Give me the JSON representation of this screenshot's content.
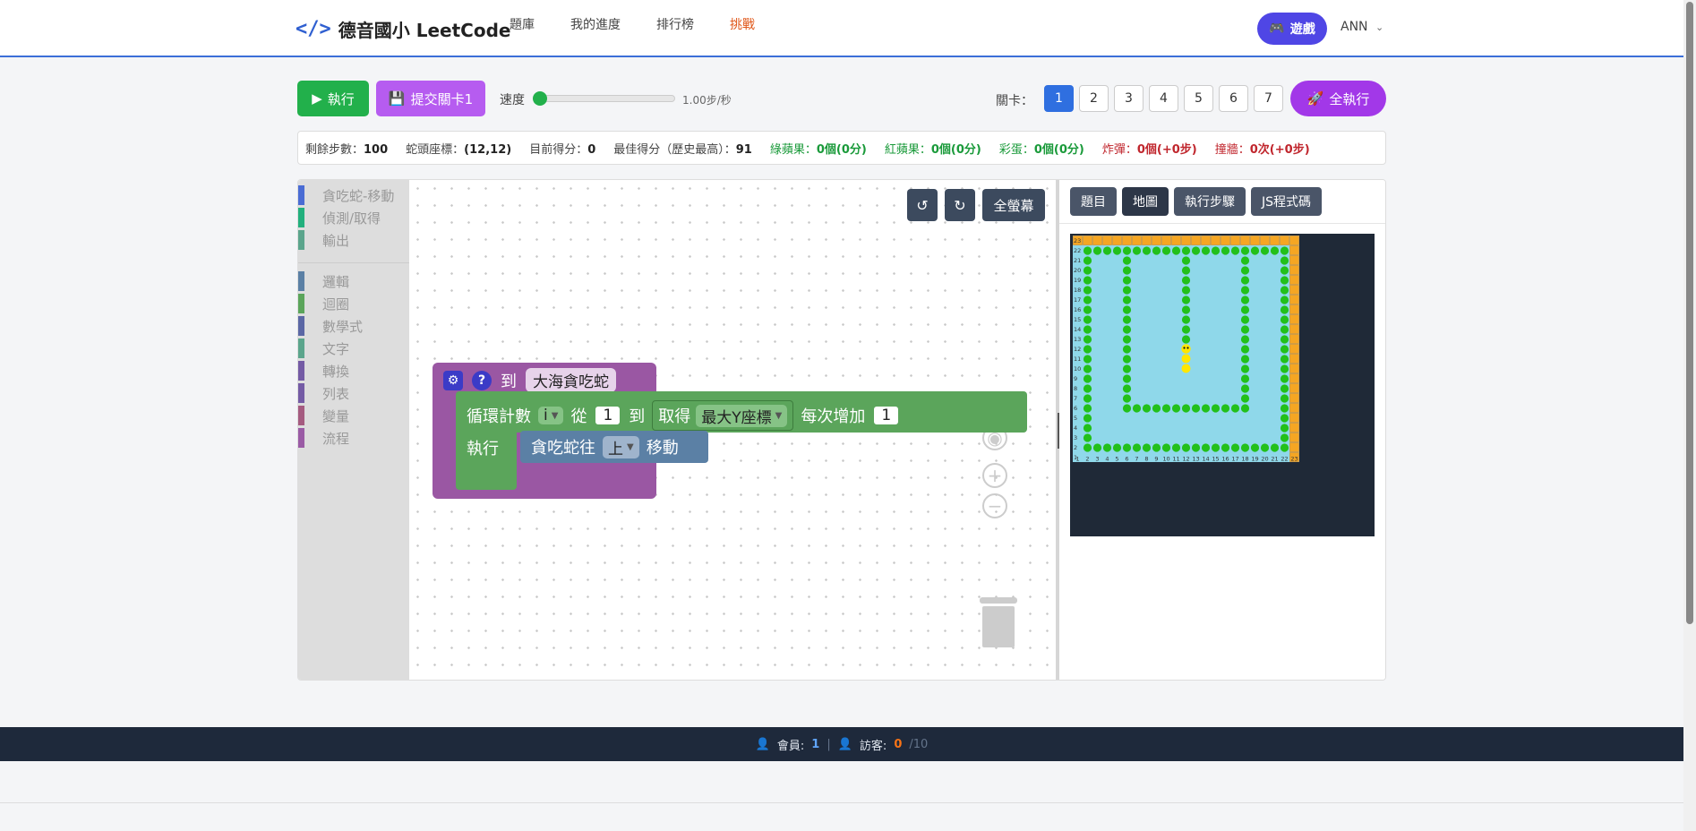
{
  "brand": {
    "name": "德音國小 LeetCode",
    "icon": "code-icon"
  },
  "nav": {
    "items": [
      {
        "label": "題庫",
        "active": false
      },
      {
        "label": "我的進度",
        "active": false
      },
      {
        "label": "排行榜",
        "active": false
      },
      {
        "label": "挑戰",
        "active": true
      }
    ],
    "game_label": "遊戲",
    "user": "ANN"
  },
  "toolbar": {
    "run_label": "執行",
    "submit_label": "提交關卡1",
    "speed_label": "速度",
    "speed_value": "1.00步/秒",
    "speed_fraction": 0,
    "level_label": "關卡：",
    "levels": [
      "1",
      "2",
      "3",
      "4",
      "5",
      "6",
      "7"
    ],
    "selected_level": "1",
    "run_all_label": "全執行"
  },
  "status": {
    "steps_label": "剩餘步數：",
    "steps": "100",
    "head_label": "蛇頭座標：",
    "head": "(12,12)",
    "score_label": "目前得分：",
    "score": "0",
    "best_label": "最佳得分（歷史最高）：",
    "best": "91",
    "green_label": "綠蘋果：",
    "green": "0個(0分)",
    "red_label": "紅蘋果：",
    "red": "0個(0分)",
    "egg_label": "彩蛋：",
    "egg": "0個(0分)",
    "bomb_label": "炸彈：",
    "bomb": "0個(+0步)",
    "wall_label": "撞牆：",
    "wall": "0次(+0步)"
  },
  "toolbox": {
    "categories": [
      {
        "label": "貪吃蛇-移動",
        "color": "#4a6cd4"
      },
      {
        "label": "偵測/取得",
        "color": "#22b07d"
      },
      {
        "label": "輸出",
        "color": "#5ba58c"
      },
      {
        "label": "邏輯",
        "color": "#5b80a5"
      },
      {
        "label": "迴圈",
        "color": "#5ba55b"
      },
      {
        "label": "數學式",
        "color": "#5b67a5"
      },
      {
        "label": "文字",
        "color": "#5ba58c"
      },
      {
        "label": "轉換",
        "color": "#745ba5"
      },
      {
        "label": "列表",
        "color": "#745ba5"
      },
      {
        "label": "變量",
        "color": "#a55b80"
      },
      {
        "label": "流程",
        "color": "#9a5ba5"
      }
    ]
  },
  "canvas": {
    "undo_icon": "undo-icon",
    "redo_icon": "redo-icon",
    "fullscreen_label": "全螢幕",
    "function_block": {
      "to_label": "到",
      "name": "大海貪吃蛇"
    },
    "loop_block": {
      "count_label": "循環計數",
      "var": "i",
      "from_label": "從",
      "from": "1",
      "to_label": "到",
      "get_label": "取得",
      "get_value": "最大Y座標",
      "step_label": "每次增加",
      "step": "1",
      "do_label": "執行"
    },
    "move_block": {
      "prefix": "貪吃蛇往",
      "direction": "上",
      "suffix": "移動"
    }
  },
  "panel": {
    "tabs": [
      "題目",
      "地圖",
      "執行步驟",
      "JS程式碼"
    ],
    "selected_tab": "地圖"
  },
  "map": {
    "grid_size": 23,
    "snake_head": [
      12,
      12
    ],
    "snake_body": [
      [
        12,
        11
      ],
      [
        12,
        10
      ]
    ],
    "x_labels": [
      "1",
      "2",
      "3",
      "4",
      "5",
      "6",
      "7",
      "8",
      "9",
      "10",
      "11",
      "12",
      "13",
      "14",
      "15",
      "16",
      "17",
      "18",
      "19",
      "20",
      "21",
      "22",
      "23"
    ],
    "y_labels": [
      "1",
      "2",
      "3",
      "4",
      "5",
      "6",
      "7",
      "8",
      "9",
      "10",
      "11",
      "12",
      "13",
      "14",
      "15",
      "16",
      "17",
      "18",
      "19",
      "20",
      "21",
      "22",
      "23"
    ]
  },
  "footer": {
    "member_label": "會員:",
    "member_count": "1",
    "visitor_label": "訪客:",
    "visitor_count": "0",
    "visitor_max": "/10"
  },
  "colors": {
    "accent": "#2f6fe0",
    "run": "#22b04b",
    "submit": "#b65cf0",
    "run_all": "#a238e8",
    "water": "#8fd8ea",
    "apple": "#22c01a",
    "wall": "#f5a623",
    "snake": "#ffe600"
  }
}
